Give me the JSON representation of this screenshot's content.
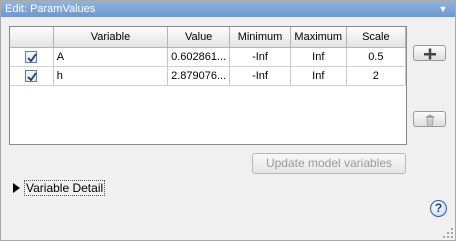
{
  "window": {
    "title": "Edit: ParamValues"
  },
  "table": {
    "columns": [
      "",
      "Variable",
      "Value",
      "Minimum",
      "Maximum",
      "Scale"
    ],
    "rows": [
      {
        "checked": true,
        "variable": "A",
        "value": "0.602861...",
        "minimum": "-Inf",
        "maximum": "Inf",
        "scale": "0.5"
      },
      {
        "checked": true,
        "variable": "h",
        "value": "2.879076...",
        "minimum": "-Inf",
        "maximum": "Inf",
        "scale": "2"
      }
    ]
  },
  "buttons": {
    "update_label": "Update model variables"
  },
  "detail": {
    "label": "Variable Detail"
  },
  "help": {
    "label": "?"
  }
}
